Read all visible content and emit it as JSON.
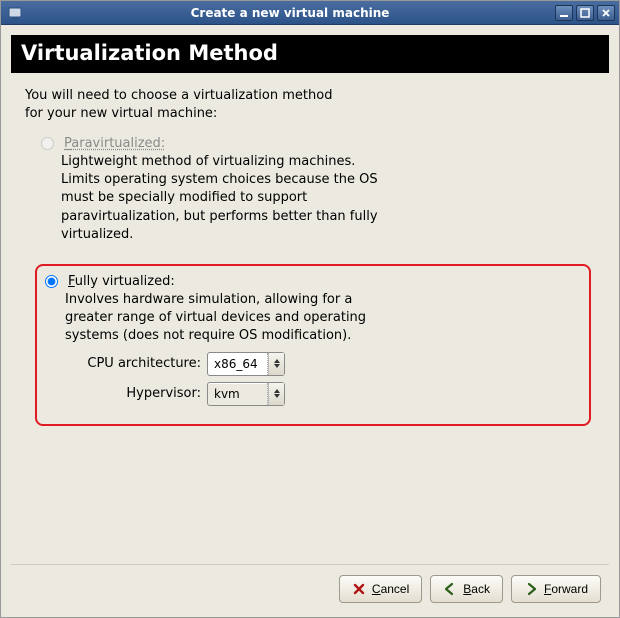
{
  "window": {
    "title": "Create a new virtual machine"
  },
  "page": {
    "heading": "Virtualization Method",
    "intro_line1": "You will need to choose a virtualization method",
    "intro_line2": "for your new virtual machine:"
  },
  "options": {
    "para": {
      "label_rest": "aravirtualized:",
      "desc": "Lightweight method of virtualizing machines. Limits operating system choices because the OS must be specially modified to support paravirtualization, but performs better than fully virtualized."
    },
    "full": {
      "label_rest": "ully virtualized:",
      "desc": "Involves hardware simulation, allowing for a greater range of virtual devices and operating systems (does not require OS modification).",
      "cpu_label": "CPU architecture:",
      "cpu_value": "x86_64",
      "hv_label": "Hypervisor:",
      "hv_value": "kvm"
    }
  },
  "buttons": {
    "cancel_rest": "ancel",
    "back_rest": "ack",
    "forward_rest": "orward"
  }
}
